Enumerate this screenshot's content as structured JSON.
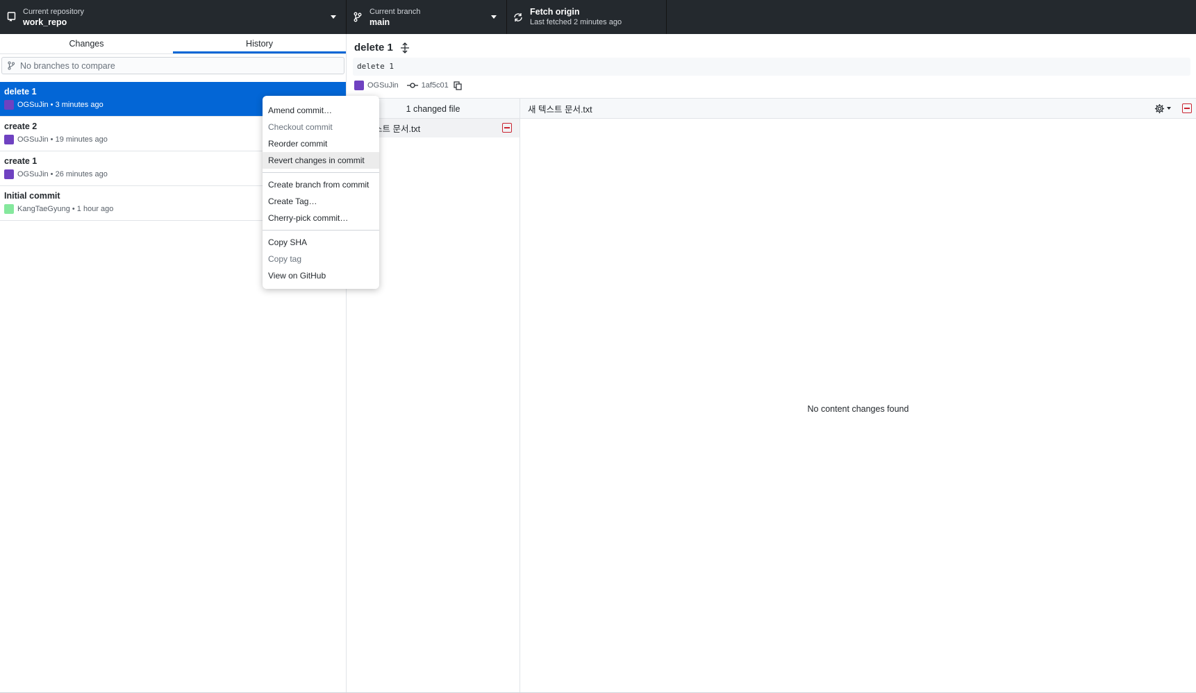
{
  "toolbar": {
    "repo": {
      "label": "Current repository",
      "value": "work_repo"
    },
    "branch": {
      "label": "Current branch",
      "value": "main"
    },
    "fetch": {
      "label": "Fetch origin",
      "status": "Last fetched 2 minutes ago"
    }
  },
  "sidebar": {
    "tabs": [
      {
        "label": "Changes"
      },
      {
        "label": "History"
      }
    ],
    "compare_placeholder": "No branches to compare",
    "commits": [
      {
        "title": "delete 1",
        "meta": "OGSuJin • 3 minutes ago"
      },
      {
        "title": "create 2",
        "meta": "OGSuJin • 19 minutes ago"
      },
      {
        "title": "create 1",
        "meta": "OGSuJin • 26 minutes ago"
      },
      {
        "title": "Initial commit",
        "meta": "KangTaeGyung • 1 hour ago"
      }
    ]
  },
  "context_menu": {
    "items": [
      {
        "label": "Amend commit…"
      },
      {
        "label": "Checkout commit"
      },
      {
        "label": "Reorder commit"
      },
      {
        "label": "Revert changes in commit"
      },
      {
        "label": "Create branch from commit"
      },
      {
        "label": "Create Tag…"
      },
      {
        "label": "Cherry-pick commit…"
      },
      {
        "label": "Copy SHA"
      },
      {
        "label": "Copy tag"
      },
      {
        "label": "View on GitHub"
      }
    ]
  },
  "detail": {
    "title": "delete 1",
    "message": "delete 1",
    "author": "OGSuJin",
    "sha": "1af5c01",
    "files_header": "1 changed file",
    "file_name": "스트 문서.txt",
    "diff_file": "새 텍스트 문서.txt",
    "empty_message": "No content changes found"
  },
  "colors": {
    "accent": "#0366d6",
    "toolbar_bg": "#24292e",
    "deleted": "#cb2431"
  }
}
